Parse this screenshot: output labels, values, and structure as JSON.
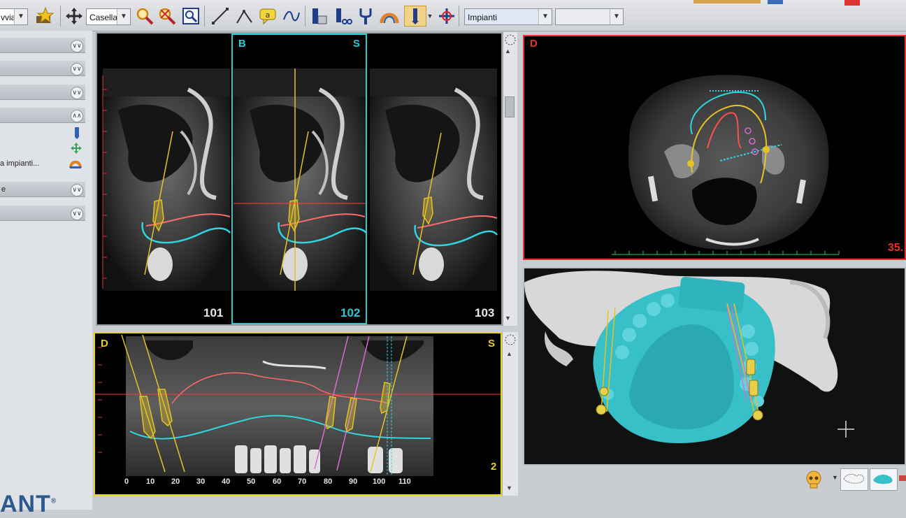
{
  "toolbar": {
    "cut_label": "vvia",
    "zoom_mode": "Casella",
    "object_select": "Impianti",
    "secondary_select": ""
  },
  "left_panel": {
    "implants_label": "a impianti...",
    "item_label": "e"
  },
  "logo": {
    "text": "ANT",
    "mark": "®"
  },
  "views": {
    "cross_sections": [
      {
        "slice": "101"
      },
      {
        "slice": "102",
        "left_label": "B",
        "right_label": "S"
      },
      {
        "slice": "103"
      }
    ],
    "axial": {
      "label": "D",
      "value": "35."
    },
    "panoramic": {
      "left_label": "D",
      "right_label": "S",
      "slice": "2",
      "ticks": [
        "0",
        "10",
        "20",
        "30",
        "40",
        "50",
        "60",
        "70",
        "80",
        "90",
        "100",
        "110"
      ]
    }
  },
  "colors": {
    "active_section": "#2ec8d0",
    "axial_border": "#e8322a",
    "panoramic_border": "#e8d21a",
    "implant": "#e6c325",
    "nerve": "#2fd6e0",
    "sinus": "#ff5a5a",
    "model": "#38c0c8"
  }
}
